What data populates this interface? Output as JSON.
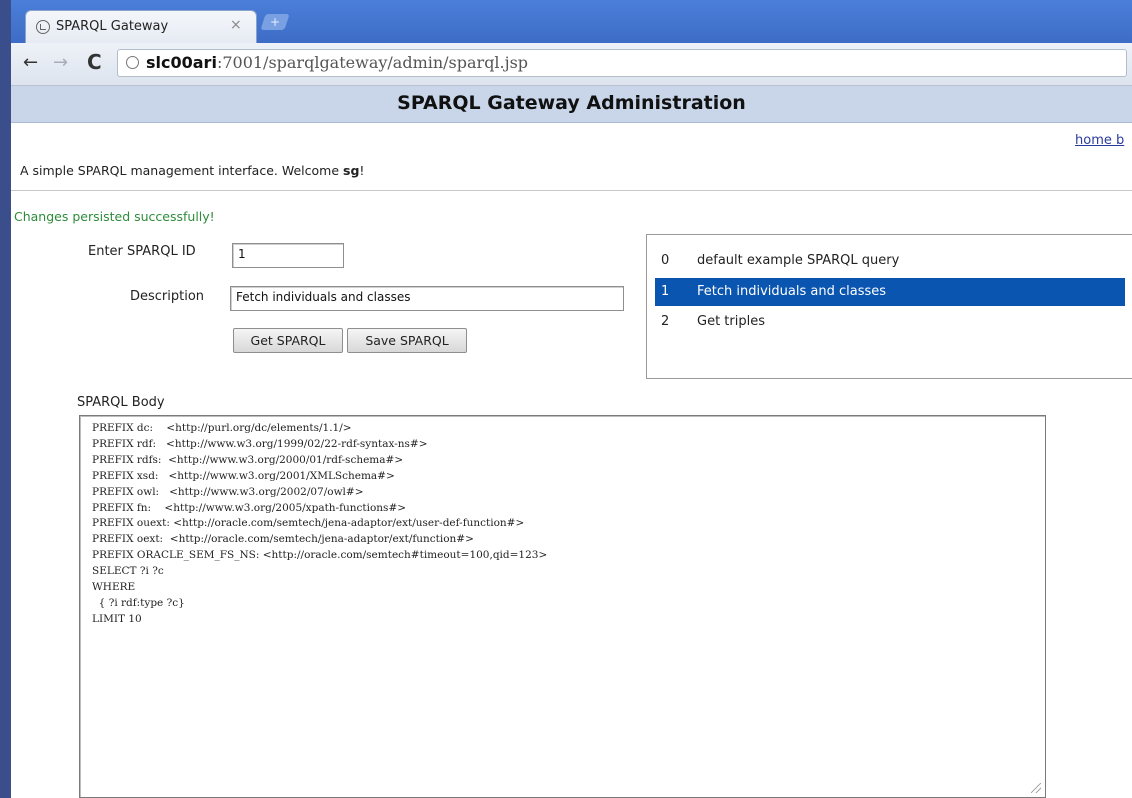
{
  "browser": {
    "tab_title": "SPARQL Gateway",
    "tab_close": "×",
    "new_tab": "+",
    "url_host": "slc00ari",
    "url_rest": ":7001/sparqlgateway/admin/sparql.jsp"
  },
  "page": {
    "title": "SPARQL Gateway Administration",
    "top_links": "home b",
    "welcome_prefix": "A simple SPARQL management interface. Welcome ",
    "welcome_user": "sg",
    "welcome_suffix": "!",
    "status_message": "Changes persisted successfully!"
  },
  "form": {
    "id_label": "Enter SPARQL ID",
    "id_value": "1",
    "description_label": "Description",
    "description_value": "Fetch individuals and classes",
    "get_button": "Get SPARQL",
    "save_button": "Save SPARQL",
    "body_label": "SPARQL Body",
    "body_text": "PREFIX dc:    <http://purl.org/dc/elements/1.1/>\nPREFIX rdf:   <http://www.w3.org/1999/02/22-rdf-syntax-ns#>\nPREFIX rdfs:  <http://www.w3.org/2000/01/rdf-schema#>\nPREFIX xsd:   <http://www.w3.org/2001/XMLSchema#>\nPREFIX owl:   <http://www.w3.org/2002/07/owl#>\nPREFIX fn:    <http://www.w3.org/2005/xpath-functions#>\nPREFIX ouext: <http://oracle.com/semtech/jena-adaptor/ext/user-def-function#>\nPREFIX oext:  <http://oracle.com/semtech/jena-adaptor/ext/function#>\nPREFIX ORACLE_SEM_FS_NS: <http://oracle.com/semtech#timeout=100,qid=123>\nSELECT ?i ?c\nWHERE\n  { ?i rdf:type ?c}\nLIMIT 10"
  },
  "query_list": [
    {
      "index": "0",
      "label": "default example SPARQL query",
      "selected": false
    },
    {
      "index": "1",
      "label": "Fetch individuals and classes",
      "selected": true
    },
    {
      "index": "2",
      "label": "Get triples",
      "selected": false
    }
  ]
}
